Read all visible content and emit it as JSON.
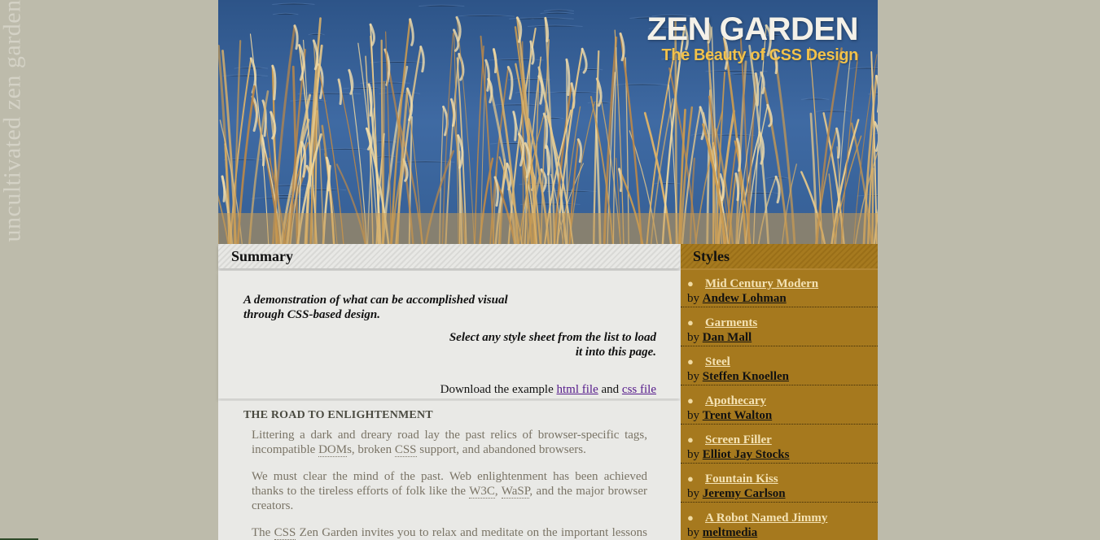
{
  "side": {
    "text": "uncultivated zen garden"
  },
  "header": {
    "title": "ZEN GARDEN",
    "subtitle": "The Beauty of CSS Design"
  },
  "summary": {
    "heading": "Summary",
    "intro1": "A demonstration of what can be accomplished visual through CSS-based design.",
    "intro2": "Select any style sheet from the list to load it into this page.",
    "download_prefix": "Download the example ",
    "html_link": "html file",
    "and_text": " and ",
    "css_link": "css file"
  },
  "road": {
    "heading": "THE ROAD TO ENLIGHTENMENT",
    "p1_a": "Littering a dark and dreary road lay the past relics of browser-specific tags, incompatible ",
    "p1_abbr1": "DOM",
    "p1_b": "s, broken ",
    "p1_abbr2": "CSS",
    "p1_c": " support, and abandoned browsers.",
    "p2_a": "We must clear the mind of the past. Web enlightenment has been achieved thanks to the tireless efforts of folk like the ",
    "p2_abbr1": "W3C",
    "p2_b": ", ",
    "p2_abbr2": "WaSP",
    "p2_c": ", and the major browser creators.",
    "p3_a": "The ",
    "p3_abbr": "CSS",
    "p3_b": " Zen Garden invites you to relax and meditate on the important lessons of the masters."
  },
  "styles": {
    "heading": "Styles",
    "by": "by ",
    "items": [
      {
        "name": "Mid Century Modern",
        "designer": "Andew Lohman"
      },
      {
        "name": "Garments",
        "designer": "Dan Mall"
      },
      {
        "name": "Steel",
        "designer": "Steffen Knoellen"
      },
      {
        "name": "Apothecary",
        "designer": "Trent Walton"
      },
      {
        "name": "Screen Filler",
        "designer": "Elliot Jay Stocks"
      },
      {
        "name": "Fountain Kiss",
        "designer": "Jeremy Carlson"
      },
      {
        "name": "A Robot Named Jimmy",
        "designer": "meltmedia"
      }
    ]
  },
  "colors": {
    "background": "#bdbbab",
    "styles_panel": "#a6791e",
    "page": "#e9e9e6"
  }
}
